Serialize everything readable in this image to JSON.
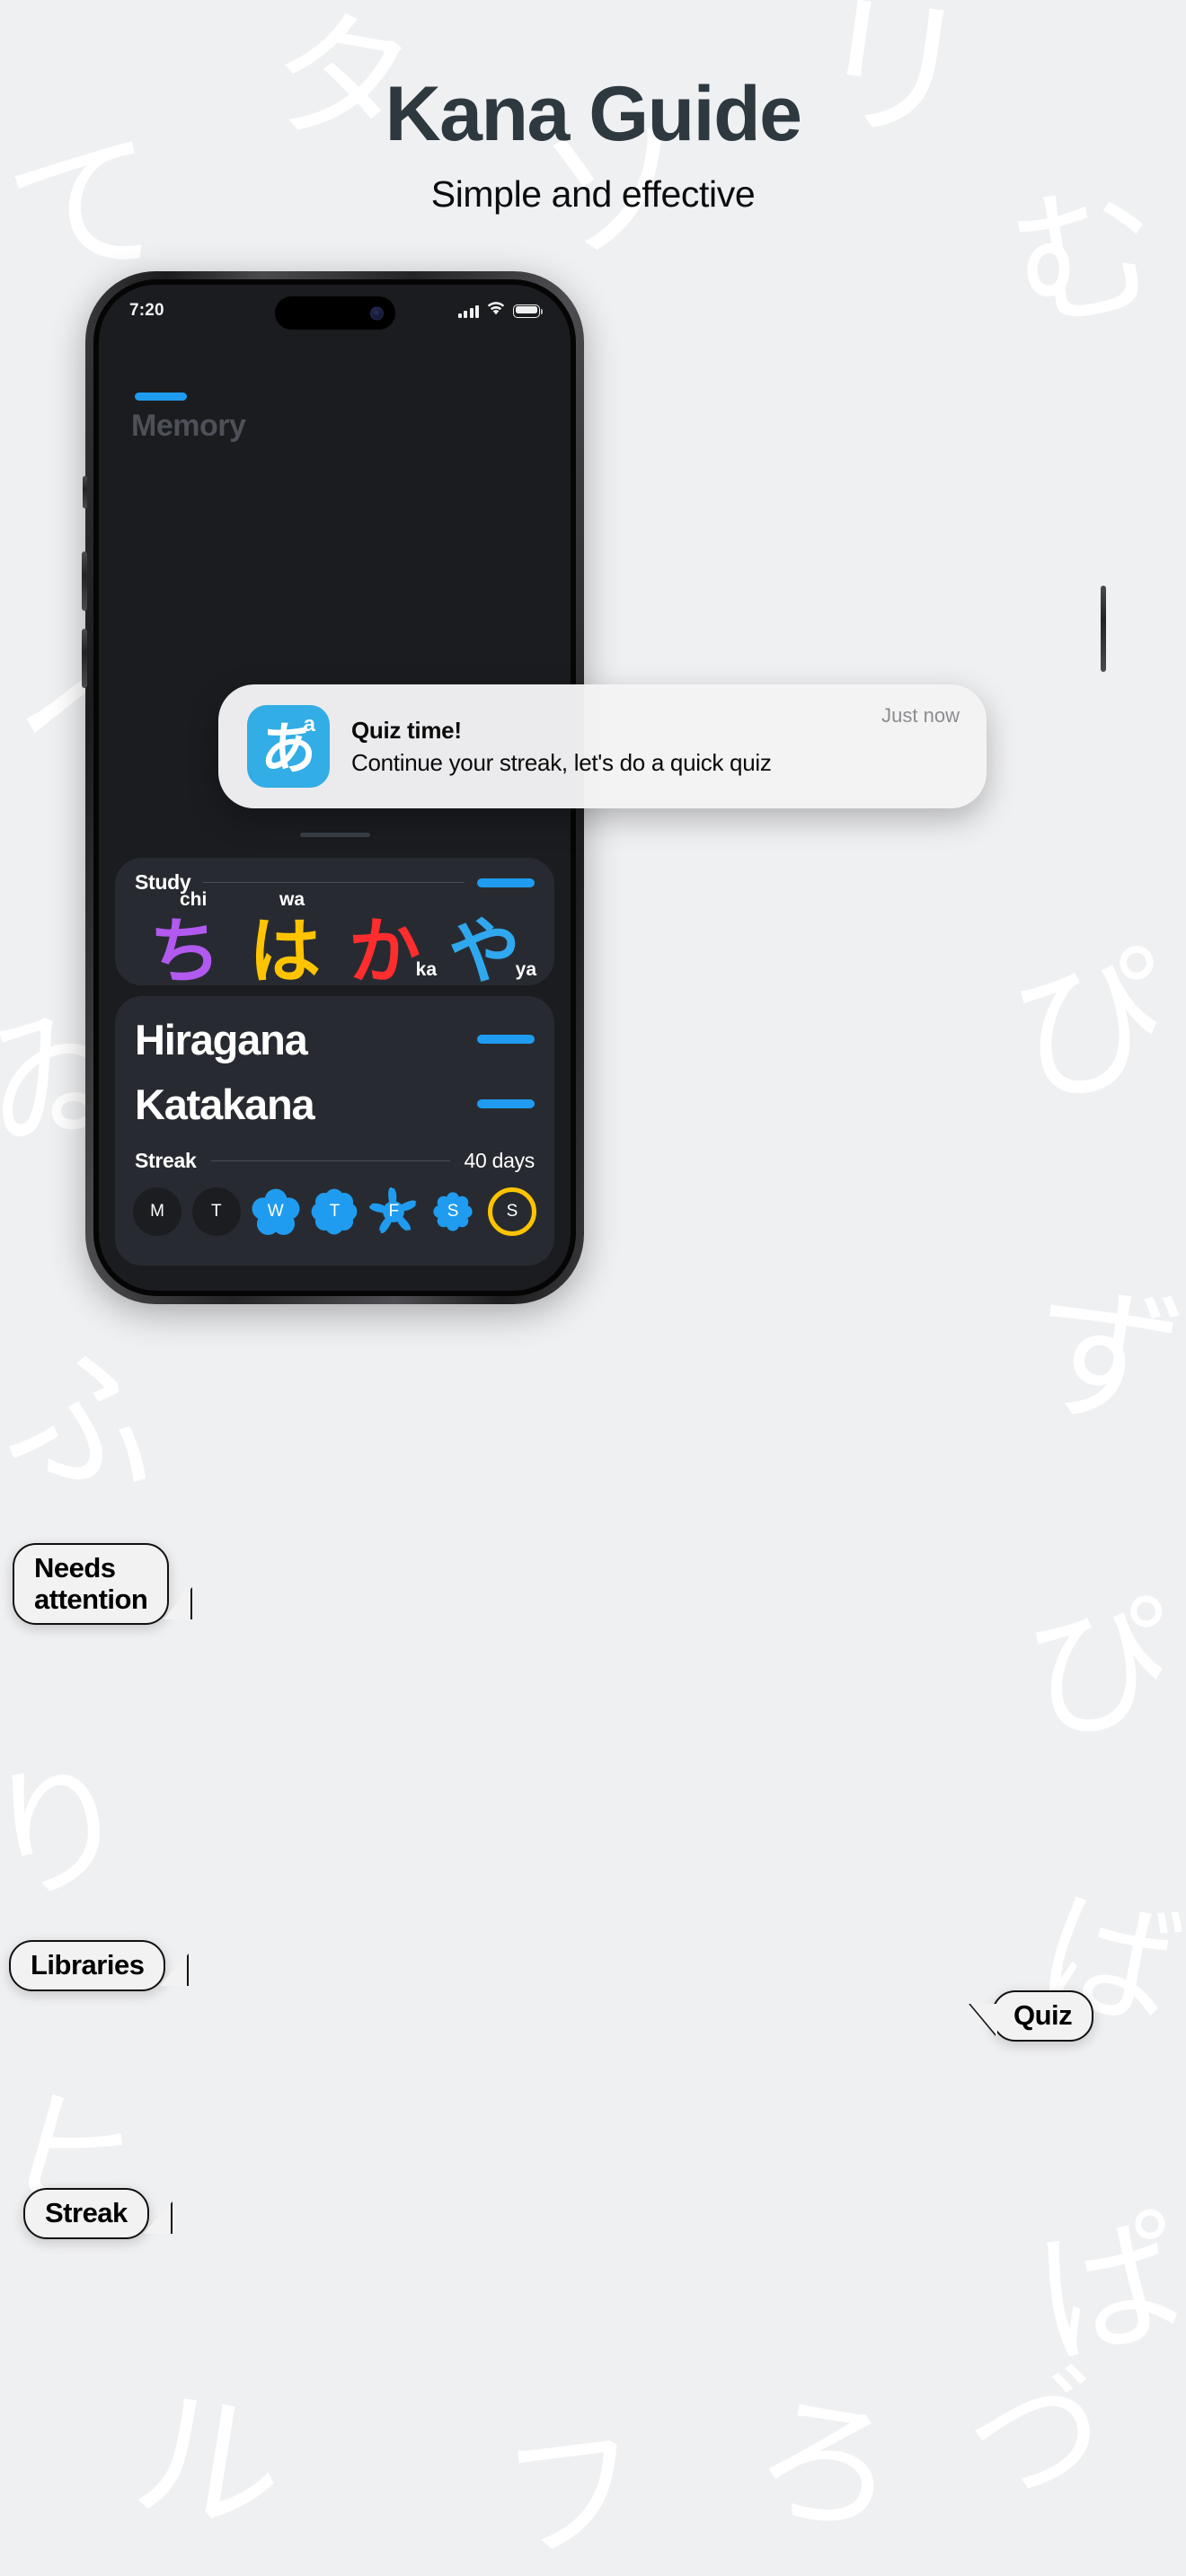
{
  "header": {
    "title": "Kana Guide",
    "subtitle": "Simple and effective",
    "title_color": "#2e383f",
    "background_color": "#eff0f2"
  },
  "background_kana": [
    "て",
    "タ",
    "ソ",
    "リ",
    "む",
    "へ",
    "フ",
    "ア",
    "ぴ",
    "ず",
    "ゐ",
    "ふ",
    "ぴ",
    "ば",
    "り",
    "ヒ",
    "ぱ",
    "ル",
    "フ",
    "ろ",
    "づ"
  ],
  "phone": {
    "status_bar": {
      "time": "7:20",
      "cellular_icon": "signal-bars-icon",
      "wifi_icon": "wifi-icon",
      "battery_icon": "battery-icon"
    },
    "notification": {
      "app_icon_kana": "あ",
      "app_icon_superscript": "a",
      "title": "Quiz time!",
      "body": "Continue your streak, let's do a quick quiz",
      "timestamp": "Just now"
    },
    "ghost_heading": "Memory",
    "study_card": {
      "label": "Study",
      "accent_color": "#1f9cf0",
      "kana": [
        {
          "glyph": "ち",
          "romaji": "chi",
          "color": "#b259f0",
          "romaji_pos": "top-left"
        },
        {
          "glyph": "は",
          "romaji": "wa",
          "color": "#ffc400",
          "romaji_pos": "top-left"
        },
        {
          "glyph": "か",
          "romaji": "ka",
          "color": "#ff2d2d",
          "romaji_pos": "bottom-right"
        },
        {
          "glyph": "や",
          "romaji": "ya",
          "color": "#2fa8ef",
          "romaji_pos": "bottom-right"
        }
      ]
    },
    "library_card": {
      "rows": [
        {
          "label": "Hiragana",
          "accent_color": "#1f9cf0"
        },
        {
          "label": "Katakana",
          "accent_color": "#1f9cf0"
        }
      ],
      "streak": {
        "label": "Streak",
        "value": "40 days",
        "days": [
          {
            "letter": "M",
            "state": "off",
            "shape": "circle"
          },
          {
            "letter": "T",
            "state": "off",
            "shape": "circle"
          },
          {
            "letter": "W",
            "state": "done",
            "shape": "flower-5",
            "color": "#1f9cf0"
          },
          {
            "letter": "T",
            "state": "done",
            "shape": "flower-8",
            "color": "#1f9cf0"
          },
          {
            "letter": "F",
            "state": "done",
            "shape": "sakura",
            "color": "#1f9cf0"
          },
          {
            "letter": "S",
            "state": "done",
            "shape": "scallop",
            "color": "#1f9cf0"
          },
          {
            "letter": "S",
            "state": "current",
            "shape": "ring",
            "color": "#ffc400"
          }
        ]
      }
    }
  },
  "callouts": [
    {
      "id": "needs-attention",
      "text": "Needs\nattention"
    },
    {
      "id": "libraries",
      "text": "Libraries"
    },
    {
      "id": "quiz",
      "text": "Quiz"
    },
    {
      "id": "streak",
      "text": "Streak"
    }
  ]
}
